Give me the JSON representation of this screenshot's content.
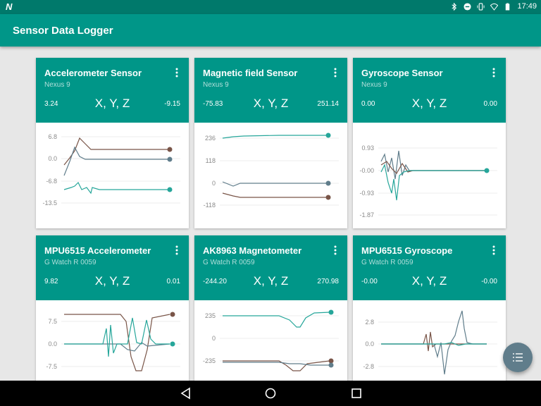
{
  "status_bar": {
    "notification_icon": "N",
    "time": "17:49",
    "icons": [
      "bluetooth-icon",
      "do-not-disturb-icon",
      "vibrate-icon",
      "wifi-icon",
      "battery-icon"
    ]
  },
  "app_bar": {
    "title": "Sensor Data Logger"
  },
  "colors": {
    "accent": "#009688",
    "dark": "#00796b",
    "series_x": "#795548",
    "series_y": "#607d8b",
    "series_z": "#26a69a"
  },
  "cards": [
    {
      "name": "Accelerometer Sensor",
      "device": "Nexus 9",
      "min": "3.24",
      "axes": "X, Y, Z",
      "max": "-9.15",
      "ticks": [
        "6.8",
        "0.0",
        "-6.8",
        "-13.5"
      ]
    },
    {
      "name": "Magnetic field Sensor",
      "device": "Nexus 9",
      "min": "-75.83",
      "axes": "X, Y, Z",
      "max": "251.14",
      "ticks": [
        "236",
        "118",
        "0",
        "-118"
      ]
    },
    {
      "name": "Gyroscope Sensor",
      "device": "Nexus 9",
      "min": "0.00",
      "axes": "X, Y, Z",
      "max": "0.00",
      "ticks": [
        "0.93",
        "-0.00",
        "-0.93",
        "-1.87"
      ]
    },
    {
      "name": "MPU6515 Accelerometer",
      "device": "G Watch R 0059",
      "min": "9.82",
      "axes": "X, Y, Z",
      "max": "0.01",
      "ticks": [
        "7.5",
        "0.0",
        "-7.5"
      ]
    },
    {
      "name": "AK8963 Magnetometer",
      "device": "G Watch R 0059",
      "min": "-244.20",
      "axes": "X, Y, Z",
      "max": "270.98",
      "ticks": [
        "235",
        "0",
        "-235"
      ]
    },
    {
      "name": "MPU6515 Gyroscope",
      "device": "G Watch R 0059",
      "min": "-0.00",
      "axes": "X, Y, Z",
      "max": "-0.00",
      "ticks": [
        "2.8",
        "0.0",
        "-2.8"
      ]
    }
  ],
  "fab": {
    "icon": "list-icon"
  },
  "nav_bar": {
    "icons": [
      "back-icon",
      "home-icon",
      "recents-icon"
    ]
  }
}
